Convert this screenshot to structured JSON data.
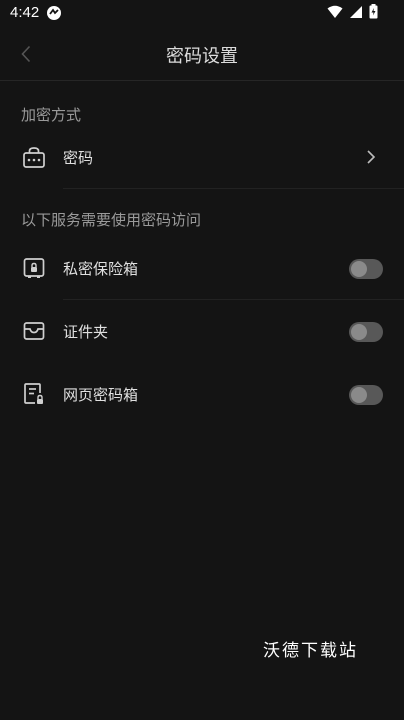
{
  "status_bar": {
    "time": "4:42",
    "icons": [
      "app-notification-icon",
      "wifi-icon",
      "signal-icon",
      "battery-icon"
    ]
  },
  "header": {
    "title": "密码设置",
    "back_icon": "chevron-left-icon"
  },
  "encryption_section": {
    "label": "加密方式",
    "item": {
      "icon": "lock-icon",
      "label": "密码",
      "chevron": "chevron-right-icon"
    }
  },
  "services_section": {
    "label": "以下服务需要使用密码访问",
    "items": [
      {
        "icon": "safe-icon",
        "label": "私密保险箱",
        "enabled": false
      },
      {
        "icon": "folder-icon",
        "label": "证件夹",
        "enabled": false
      },
      {
        "icon": "web-password-icon",
        "label": "网页密码箱",
        "enabled": false
      }
    ]
  },
  "watermark": "沃德下载站",
  "colors": {
    "background": "#141414",
    "text_primary": "#e0e0e0",
    "text_secondary": "#9a9a9a",
    "toggle_off_track": "#585858",
    "toggle_off_knob": "#8a8a8a"
  }
}
